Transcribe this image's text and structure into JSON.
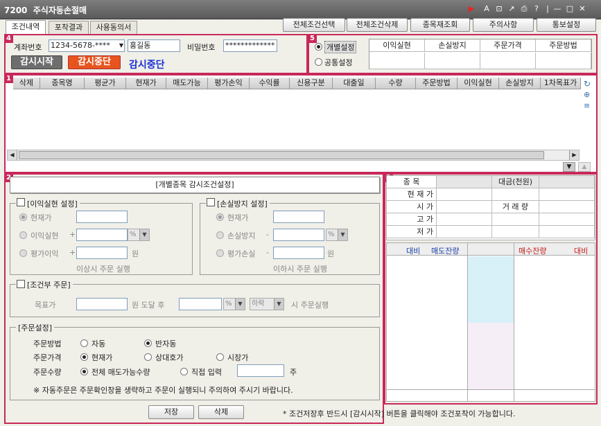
{
  "window": {
    "code": "7200",
    "title": "주식자동손절매"
  },
  "tabs": [
    "조건내역",
    "포착결과",
    "사용동의서"
  ],
  "top_buttons": [
    "전체조건선택",
    "전체조건삭제",
    "종목재조회",
    "주의사항",
    "통보설정"
  ],
  "account": {
    "label": "계좌번호",
    "number": "1234-5678-****",
    "name": "홍길동",
    "pw_label": "비밀번호",
    "pw": "*************"
  },
  "monitor": {
    "start": "감시시작",
    "stop": "감시중단",
    "status": "감시중단"
  },
  "mode": {
    "individual": "개별설정",
    "common": "공통설정"
  },
  "cond_header": [
    "이익실현",
    "손실방지",
    "주문가격",
    "주문방법"
  ],
  "grid_headers": [
    "삭제",
    "종목명",
    "평균가",
    "현재가",
    "매도가능",
    "평가손익",
    "수익률",
    "신용구분",
    "대출일",
    "수량",
    "주문방법",
    "이익실현",
    "손실방지",
    "1차목표가"
  ],
  "cond_title": "[개별종목 감시조건설정]",
  "profit": {
    "title": "[이익실현 설정]",
    "cur": "현재가",
    "realize": "이익실현",
    "eval": "평가이익",
    "pct": "%",
    "won": "원",
    "note": "이상시 주문 실행",
    "plus": "+"
  },
  "loss": {
    "title": "[손실방지 설정]",
    "cur": "현재가",
    "prevent": "손실방지",
    "eval": "평가손실",
    "pct": "%",
    "won": "원",
    "note": "이하시 주문 실행",
    "minus": "-"
  },
  "cond_order": {
    "title": "[조건부 주문]",
    "target": "목표가",
    "reach": "원 도달 후",
    "pct": "%",
    "dir": "하락",
    "exec": "시 주문실행"
  },
  "order": {
    "title": "[주문설정]",
    "method_label": "주문방법",
    "auto": "자동",
    "semi": "반자동",
    "price_label": "주문가격",
    "cur": "현재가",
    "opp": "상대호가",
    "market": "시장가",
    "qty_label": "주문수량",
    "all": "전체 매도가능수량",
    "direct": "직접 입력",
    "unit": "주",
    "warn": "※ 자동주문은 주문확인창을 생략하고 주문이 실행되니 주의하여 주시기 바랍니다."
  },
  "save": "저장",
  "delete": "삭제",
  "footnote": "* 조건저장후 반드시 [감시시작] 버튼을 클릭해야 조건포착이 가능합니다.",
  "quote": {
    "item": "종 목",
    "amount": "대금(천원)",
    "cur": "현 재 가",
    "open": "시 가",
    "volume": "거 래 량",
    "high": "고 가",
    "low": "저 가",
    "d1": "대비",
    "ask": "매도잔량",
    "bid": "매수잔량",
    "d2": "대비"
  },
  "colors": {
    "accent": "#c8285a",
    "start_btn": "#6e6e6e",
    "stop_btn": "#e8541e",
    "status": "#1a2fd6"
  }
}
